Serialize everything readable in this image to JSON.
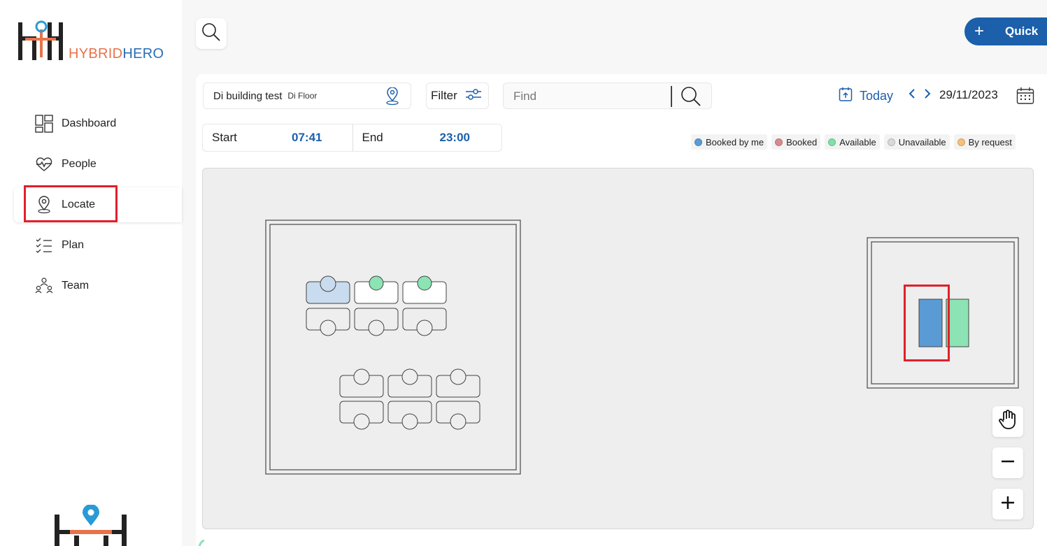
{
  "app": {
    "logo_hybrid": "HYBRID",
    "logo_hero": "HERO"
  },
  "sidebar": {
    "items": [
      {
        "label": "Dashboard",
        "icon": "dashboard-icon"
      },
      {
        "label": "People",
        "icon": "heart-pulse-icon"
      },
      {
        "label": "Locate",
        "icon": "location-pin-icon",
        "active": true
      },
      {
        "label": "Plan",
        "icon": "checklist-icon"
      },
      {
        "label": "Team",
        "icon": "team-icon"
      }
    ]
  },
  "header": {
    "search_icon": "search-icon",
    "quick_label": "Quick",
    "quick_icon": "plus-icon"
  },
  "toolbar": {
    "building": "Di building test",
    "floor": "Di Floor",
    "filter_label": "Filter",
    "find_placeholder": "Find",
    "today_label": "Today",
    "date": "29/11/2023"
  },
  "time": {
    "start_label": "Start",
    "start_value": "07:41",
    "end_label": "End",
    "end_value": "23:00"
  },
  "legend": [
    {
      "label": "Booked by me",
      "color": "#5b9bd5"
    },
    {
      "label": "Booked",
      "color": "#d98a8a"
    },
    {
      "label": "Available",
      "color": "#7fe0a8"
    },
    {
      "label": "Unavailable",
      "color": "#d9d9d9"
    },
    {
      "label": "By request",
      "color": "#f5c07a"
    }
  ],
  "colors": {
    "accent": "#1c5fab",
    "booked_by_me": "#5b9bd5",
    "available": "#7fe0a8",
    "highlight": "#e0202a"
  },
  "map_controls": {
    "pan_icon": "hand-icon",
    "zoom_out_icon": "minus-icon",
    "zoom_in_icon": "plus-icon"
  }
}
